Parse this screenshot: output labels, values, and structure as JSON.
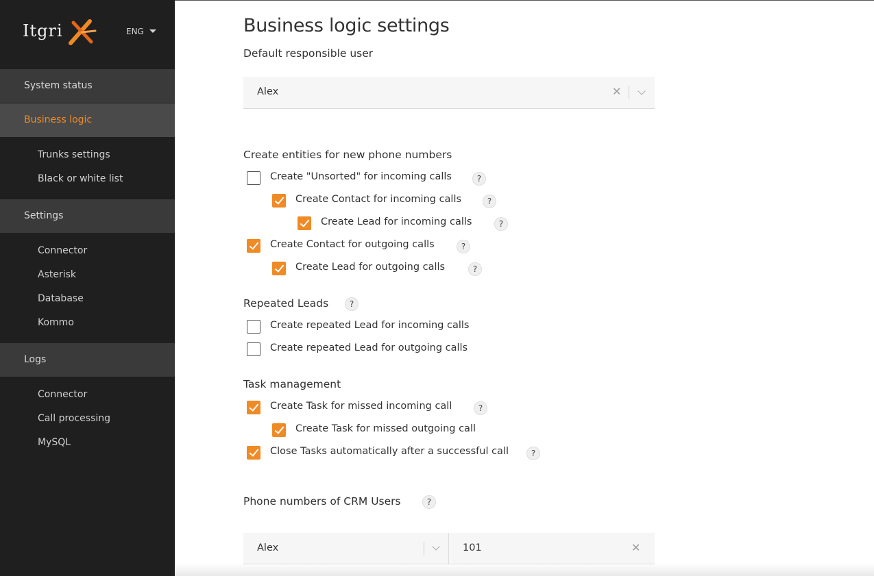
{
  "brand": {
    "logo_text": "Itgri",
    "language": "ENG"
  },
  "sidebar": {
    "sections": [
      {
        "label": "System status",
        "active": false
      },
      {
        "label": "Business logic",
        "active": true
      },
      {
        "label": "Settings",
        "active": false
      },
      {
        "label": "Logs",
        "active": false
      }
    ],
    "business_logic_items": [
      "Trunks settings",
      "Black or white list"
    ],
    "settings_items": [
      "Connector",
      "Asterisk",
      "Database",
      "Kommo"
    ],
    "logs_items": [
      "Connector",
      "Call processing",
      "MySQL"
    ]
  },
  "page": {
    "title": "Business logic settings",
    "default_user": {
      "label": "Default responsible user",
      "value": "Alex"
    },
    "create_entities": {
      "label": "Create entities for new phone numbers",
      "options": [
        {
          "label": "Create \"Unsorted\" for incoming calls",
          "checked": false
        },
        {
          "label": "Create Contact for incoming calls",
          "checked": true
        },
        {
          "label": "Create Lead for incoming calls",
          "checked": true
        },
        {
          "label": "Create Contact for outgoing calls",
          "checked": true
        },
        {
          "label": "Create Lead for outgoing calls",
          "checked": true
        }
      ]
    },
    "repeated_leads": {
      "label": "Repeated Leads",
      "options": [
        {
          "label": "Create repeated Lead for incoming calls",
          "checked": false
        },
        {
          "label": "Create repeated Lead for outgoing calls",
          "checked": false
        }
      ]
    },
    "task_management": {
      "label": "Task management",
      "options": [
        {
          "label": "Create Task for missed incoming call",
          "checked": true
        },
        {
          "label": "Create Task for missed outgoing call",
          "checked": true
        },
        {
          "label": "Close Tasks automatically after a successful call",
          "checked": true
        }
      ]
    },
    "crm_users": {
      "label": "Phone numbers of CRM Users",
      "user_value": "Alex",
      "phone_value": "101"
    },
    "help_glyph": "?"
  },
  "colors": {
    "accent": "#f08a24",
    "sidebar_bg": "#1f1f1f",
    "section_bg": "#3a3a3a"
  }
}
